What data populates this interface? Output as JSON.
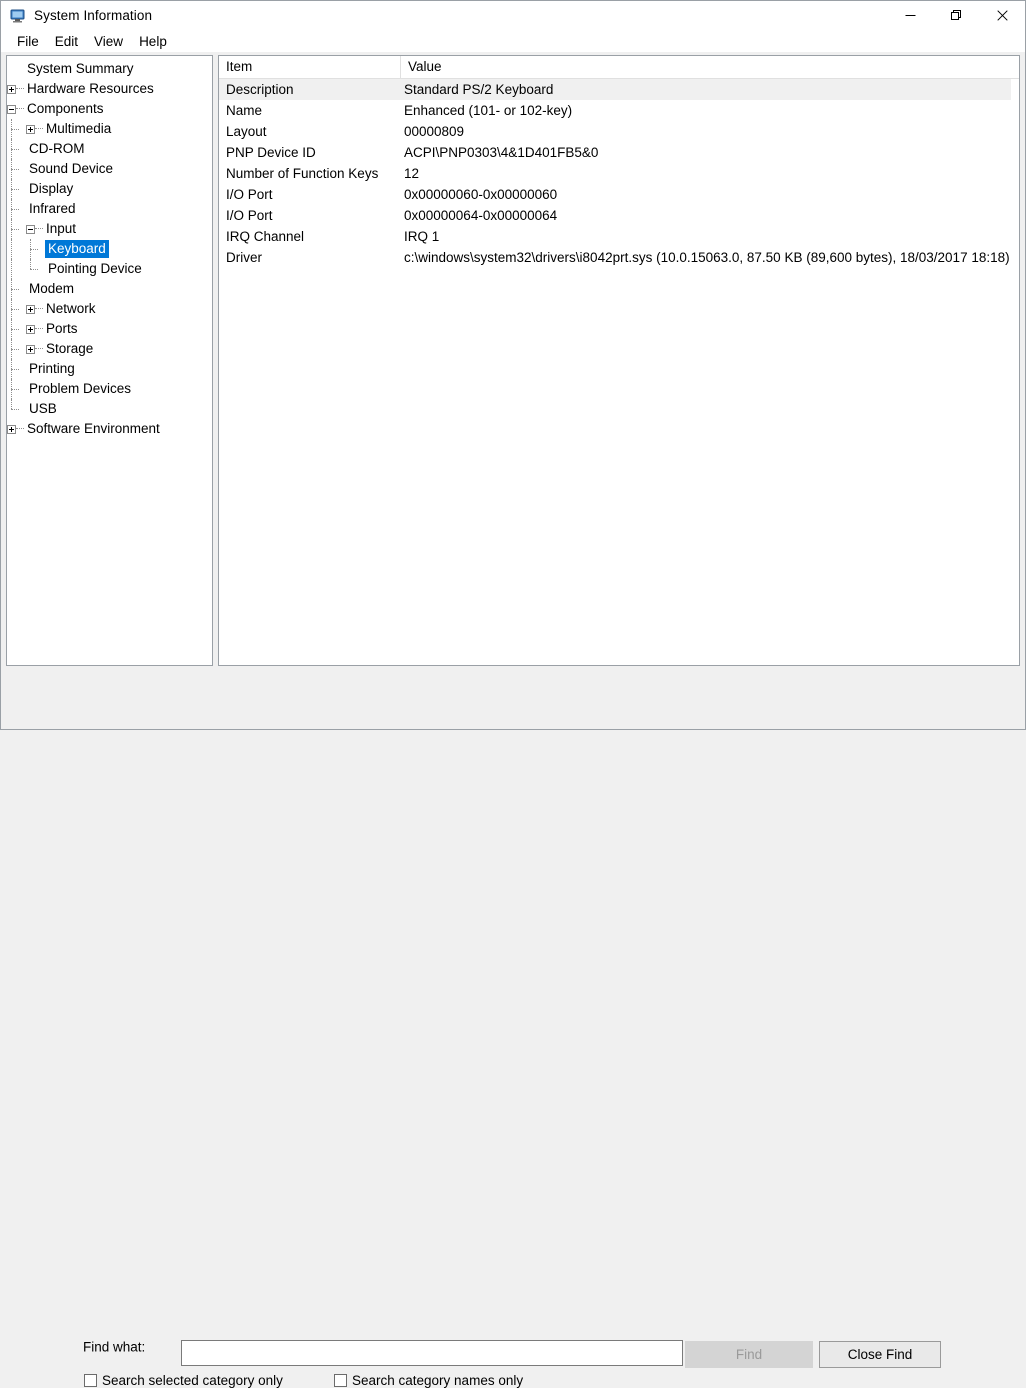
{
  "window": {
    "title": "System Information",
    "icon": "system-information-icon",
    "controls": {
      "minimize": "minimize-icon",
      "restore": "restore-icon",
      "close": "close-icon"
    }
  },
  "menu": {
    "items": [
      "File",
      "Edit",
      "View",
      "Help"
    ]
  },
  "tree": {
    "selected": "Keyboard",
    "selection_color": "#0078d7",
    "nodes": [
      {
        "label": "System Summary",
        "depth": 0,
        "expander": "none",
        "last": false
      },
      {
        "label": "Hardware Resources",
        "depth": 0,
        "expander": "plus",
        "last": false
      },
      {
        "label": "Components",
        "depth": 0,
        "expander": "minus",
        "last": false
      },
      {
        "label": "Multimedia",
        "depth": 1,
        "expander": "plus",
        "last": false
      },
      {
        "label": "CD-ROM",
        "depth": 1,
        "expander": "none",
        "last": false
      },
      {
        "label": "Sound Device",
        "depth": 1,
        "expander": "none",
        "last": false
      },
      {
        "label": "Display",
        "depth": 1,
        "expander": "none",
        "last": false
      },
      {
        "label": "Infrared",
        "depth": 1,
        "expander": "none",
        "last": false
      },
      {
        "label": "Input",
        "depth": 1,
        "expander": "minus",
        "last": false
      },
      {
        "label": "Keyboard",
        "depth": 2,
        "expander": "none",
        "last": false
      },
      {
        "label": "Pointing Device",
        "depth": 2,
        "expander": "none",
        "last": true
      },
      {
        "label": "Modem",
        "depth": 1,
        "expander": "none",
        "last": false
      },
      {
        "label": "Network",
        "depth": 1,
        "expander": "plus",
        "last": false
      },
      {
        "label": "Ports",
        "depth": 1,
        "expander": "plus",
        "last": false
      },
      {
        "label": "Storage",
        "depth": 1,
        "expander": "plus",
        "last": false
      },
      {
        "label": "Printing",
        "depth": 1,
        "expander": "none",
        "last": false
      },
      {
        "label": "Problem Devices",
        "depth": 1,
        "expander": "none",
        "last": false
      },
      {
        "label": "USB",
        "depth": 1,
        "expander": "none",
        "last": true
      },
      {
        "label": "Software Environment",
        "depth": 0,
        "expander": "plus",
        "last": true
      }
    ]
  },
  "list": {
    "columns": [
      "Item",
      "Value"
    ],
    "rows": [
      {
        "item": "Description",
        "value": "Standard PS/2 Keyboard",
        "highlight": true
      },
      {
        "item": "Name",
        "value": "Enhanced (101- or 102-key)",
        "highlight": false
      },
      {
        "item": "Layout",
        "value": "00000809",
        "highlight": false
      },
      {
        "item": "PNP Device ID",
        "value": "ACPI\\PNP0303\\4&1D401FB5&0",
        "highlight": false
      },
      {
        "item": "Number of Function Keys",
        "value": "12",
        "highlight": false
      },
      {
        "item": "I/O Port",
        "value": "0x00000060-0x00000060",
        "highlight": false
      },
      {
        "item": "I/O Port",
        "value": "0x00000064-0x00000064",
        "highlight": false
      },
      {
        "item": "IRQ Channel",
        "value": "IRQ 1",
        "highlight": false
      },
      {
        "item": "Driver",
        "value": "c:\\windows\\system32\\drivers\\i8042prt.sys (10.0.15063.0, 87.50 KB (89,600 bytes), 18/03/2017 18:18)",
        "highlight": false
      }
    ]
  },
  "find": {
    "label": "Find what:",
    "input_value": "",
    "input_placeholder": "",
    "find_button": "Find",
    "find_button_enabled": false,
    "close_button": "Close Find",
    "checkbox_selected_category": "Search selected category only",
    "checkbox_selected_category_checked": false,
    "checkbox_category_names": "Search category names only",
    "checkbox_category_names_checked": false
  }
}
